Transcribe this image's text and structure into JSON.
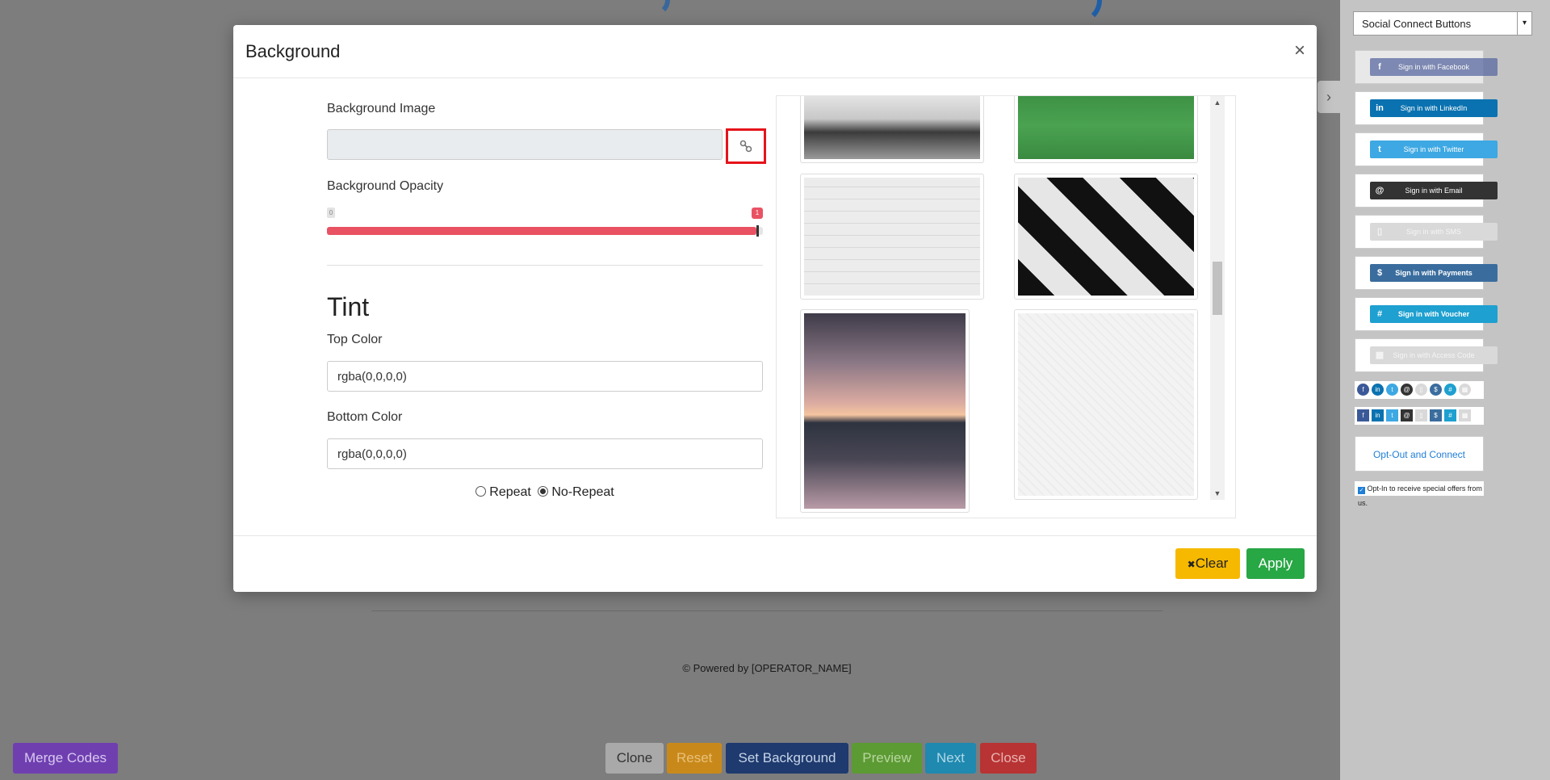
{
  "page": {
    "powered_by": "© Powered by [OPERATOR_NAME]",
    "bottom_buttons": [
      {
        "label": "Merge Codes",
        "color": "#6f3fb0"
      },
      {
        "label": "Clone",
        "color": "#a9a9a9"
      },
      {
        "label": "Reset",
        "color": "#c9891a"
      },
      {
        "label": "Set Background",
        "color": "#1e3a6e"
      },
      {
        "label": "Preview",
        "color": "#5c9a33"
      },
      {
        "label": "Next",
        "color": "#1f89b0"
      },
      {
        "label": "Close",
        "color": "#b83333"
      }
    ]
  },
  "right_panel": {
    "select_value": "Social Connect Buttons",
    "social_buttons": [
      {
        "label": "Sign in with Facebook",
        "icon": "f",
        "color": "#5a6aa0"
      },
      {
        "label": "Sign in with LinkedIn",
        "icon": "in",
        "color": "#0a72b0"
      },
      {
        "label": "Sign in with Twitter",
        "icon": "t",
        "color": "#3da8e3"
      },
      {
        "label": "Sign in with Email",
        "icon": "@",
        "color": "#333333"
      },
      {
        "label": "Sign in with SMS",
        "icon": "▯",
        "color": "#d9d9d9"
      },
      {
        "label": "Sign in with Payments",
        "icon": "$",
        "color": "#3a6d9e"
      },
      {
        "label": "Sign in with Voucher",
        "icon": "#",
        "color": "#1ea0d0"
      },
      {
        "label": "Sign in with Access Code",
        "icon": "▦",
        "color": "#d9d9d9"
      }
    ],
    "opt_out_label": "Opt-Out and Connect",
    "opt_in_label": "Opt-In to receive special offers from us."
  },
  "modal": {
    "title": "Background",
    "close_symbol": "×",
    "background_image_label": "Background Image",
    "background_image_value": "",
    "background_opacity_label": "Background Opacity",
    "opacity_min": "0",
    "opacity_max": "1",
    "opacity_value": 1,
    "tint_heading": "Tint",
    "top_color_label": "Top Color",
    "top_color_value": "rgba(0,0,0,0)",
    "bottom_color_label": "Bottom Color",
    "bottom_color_value": "rgba(0,0,0,0)",
    "repeat_label": "Repeat",
    "no_repeat_label": "No-Repeat",
    "repeat_selected": "no-repeat",
    "clear_label": "Clear",
    "clear_icon": "✖",
    "apply_label": "Apply"
  }
}
